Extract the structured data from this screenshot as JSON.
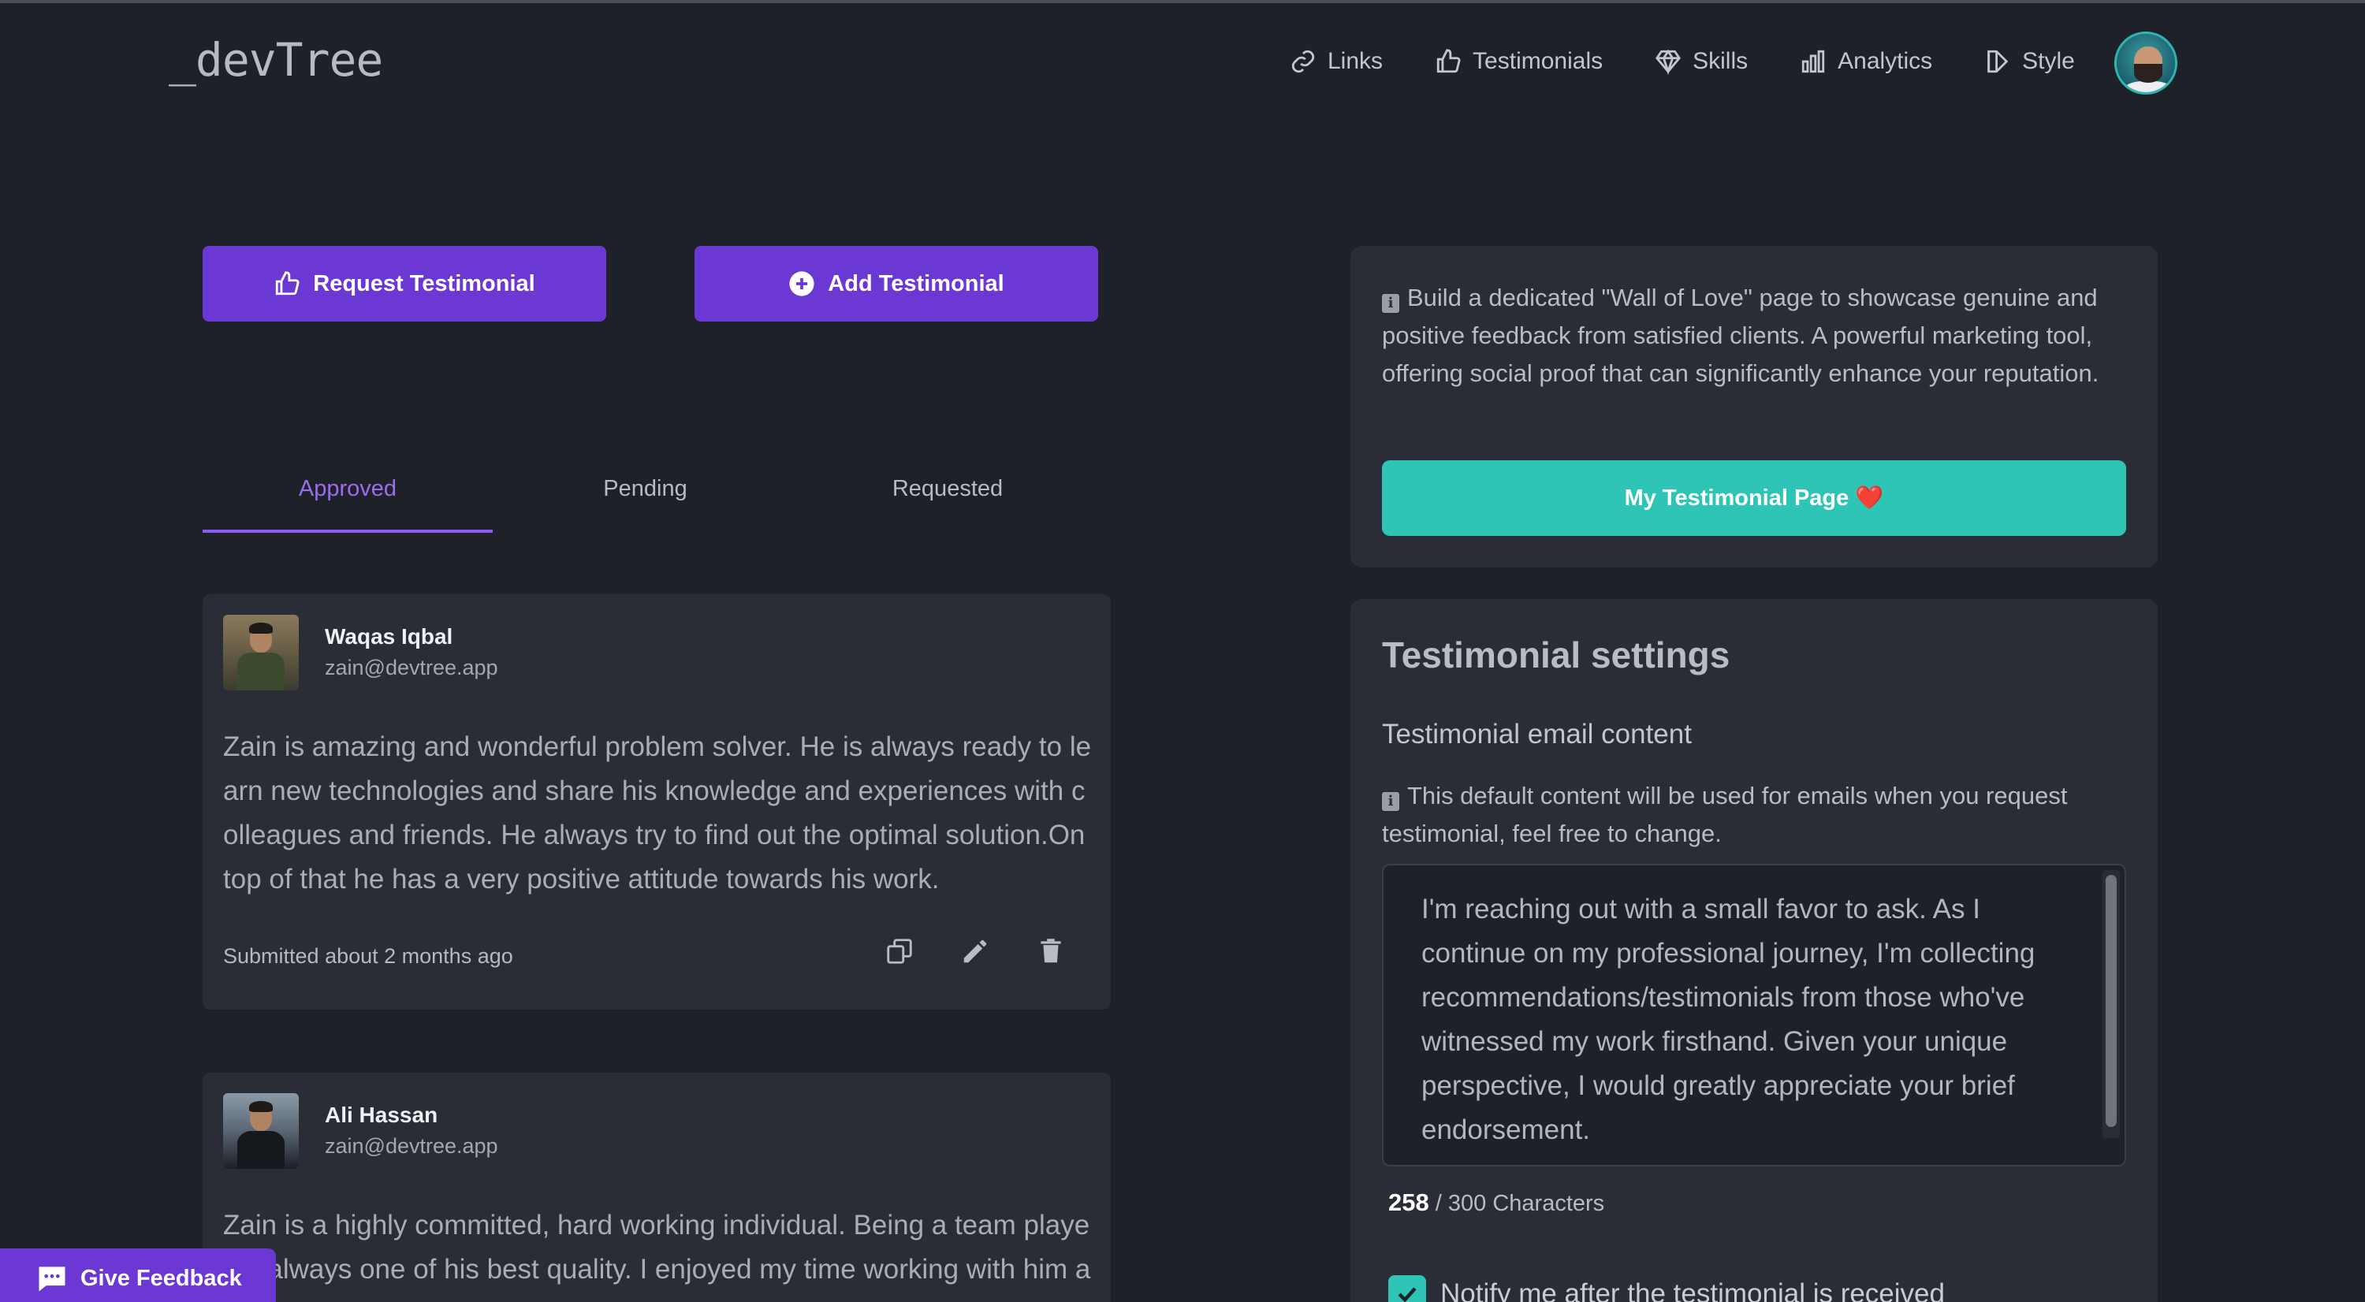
{
  "app": {
    "logo": "_devTree"
  },
  "nav": {
    "items": [
      {
        "label": "Links",
        "icon": "link-icon"
      },
      {
        "label": "Testimonials",
        "icon": "thumbs-up-icon"
      },
      {
        "label": "Skills",
        "icon": "diamond-icon"
      },
      {
        "label": "Analytics",
        "icon": "bar-chart-icon"
      },
      {
        "label": "Style",
        "icon": "palette-icon"
      }
    ]
  },
  "actions": {
    "request_label": "Request Testimonial",
    "add_label": "Add Testimonial"
  },
  "tabs": [
    {
      "label": "Approved",
      "active": true
    },
    {
      "label": "Pending",
      "active": false
    },
    {
      "label": "Requested",
      "active": false
    }
  ],
  "testimonials": [
    {
      "name": "Waqas Iqbal",
      "email": "zain@devtree.app",
      "text": "Zain is amazing and wonderful problem solver. He is always ready to learn new technologies and share his knowledge and experiences with colleagues and friends. He always try to find out the optimal solution.On top of that he has a very positive attitude towards his work.",
      "meta": "Submitted about 2 months ago"
    },
    {
      "name": "Ali Hassan",
      "email": "zain@devtree.app",
      "text": "Zain is a highly committed, hard working individual. Being a team player is always one of his best quality. I enjoyed my time working with him and wish him every success and dedication."
    }
  ],
  "info_panel": {
    "text": "Build a dedicated \"Wall of Love\" page to showcase genuine and positive feedback from satisfied clients. A powerful marketing tool, offering social proof that can significantly enhance your reputation.",
    "button_label": "My Testimonial Page ❤️"
  },
  "settings": {
    "title": "Testimonial settings",
    "email_content_label": "Testimonial email content",
    "note": "This default content will be used for emails when you request testimonial, feel free to change.",
    "email_content": "I'm reaching out with a small favor to ask. As I continue on my professional journey, I'm collecting recommendations/testimonials from those who've witnessed my work firsthand. Given your unique perspective, I would greatly appreciate your brief endorsement.",
    "char_count": "258",
    "char_limit_text": "/ 300 Characters",
    "notify_label": "Notify me after the testimonial is received",
    "notify_checked": true
  },
  "feedback": {
    "label": "Give Feedback"
  },
  "colors": {
    "accent_purple": "#6b38d4",
    "accent_teal": "#2ec4b6",
    "background": "#1f2128",
    "card": "#2a2d35"
  }
}
